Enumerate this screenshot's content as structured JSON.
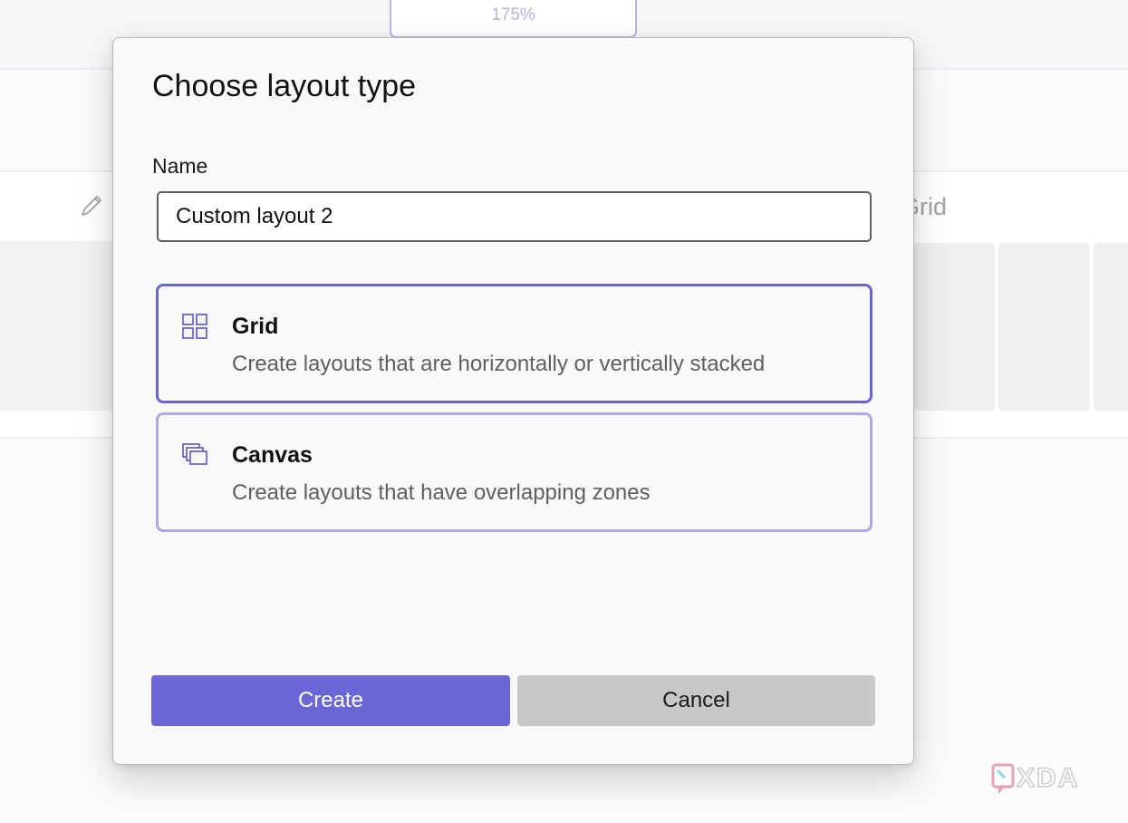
{
  "background": {
    "zoom_label": "175%",
    "grid_label": "Grid"
  },
  "dialog": {
    "title": "Choose layout type",
    "name_label": "Name",
    "name_value": "Custom layout 2",
    "options": [
      {
        "title": "Grid",
        "description": "Create layouts that are horizontally or vertically stacked",
        "icon": "grid-icon",
        "selected": true
      },
      {
        "title": "Canvas",
        "description": "Create layouts that have overlapping zones",
        "icon": "canvas-icon",
        "selected": false
      }
    ],
    "create_label": "Create",
    "cancel_label": "Cancel"
  },
  "colors": {
    "accent": "#6b67d6",
    "selected_border": "#6b67c9",
    "unselected_border": "#ada9e1",
    "cancel_bg": "#c8c8c8"
  },
  "watermark": {
    "text": "XDA"
  }
}
